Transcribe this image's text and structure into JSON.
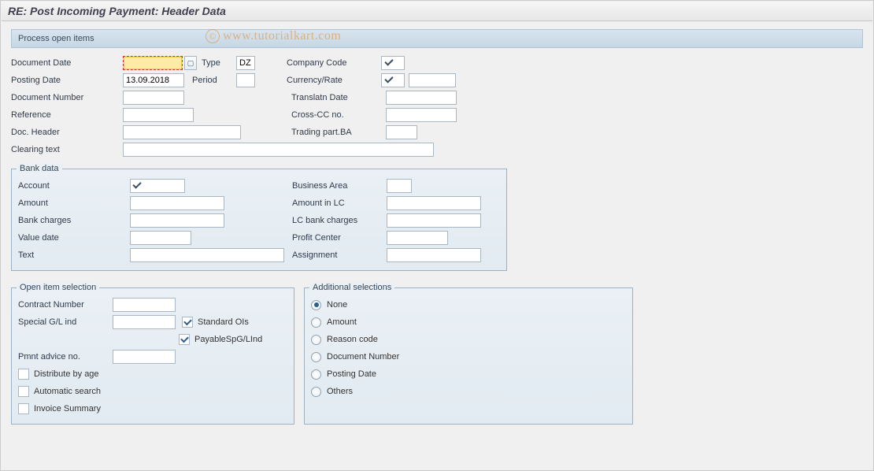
{
  "title": "RE: Post Incoming Payment: Header Data",
  "toolbar": {
    "process_open_items": "Process open items"
  },
  "watermark": "www.tutorialkart.com",
  "header": {
    "document_date_label": "Document Date",
    "document_date": "",
    "type_label": "Type",
    "type": "DZ",
    "posting_date_label": "Posting Date",
    "posting_date": "13.09.2018",
    "period_label": "Period",
    "period": "",
    "document_number_label": "Document Number",
    "document_number": "",
    "reference_label": "Reference",
    "reference": "",
    "doc_header_label": "Doc. Header",
    "doc_header": "",
    "clearing_text_label": "Clearing text",
    "clearing_text": "",
    "company_code_label": "Company Code",
    "company_code": "",
    "currency_rate_label": "Currency/Rate",
    "currency_rate_a": "",
    "currency_rate_b": "",
    "translatn_date_label": "Translatn Date",
    "translatn_date": "",
    "cross_cc_label": "Cross-CC no.",
    "cross_cc": "",
    "trading_part_label": "Trading part.BA",
    "trading_part": ""
  },
  "bank": {
    "legend": "Bank data",
    "account_label": "Account",
    "account": "",
    "amount_label": "Amount",
    "amount": "",
    "bank_charges_label": "Bank charges",
    "bank_charges": "",
    "value_date_label": "Value date",
    "value_date": "",
    "text_label": "Text",
    "text": "",
    "business_area_label": "Business Area",
    "business_area": "",
    "amount_lc_label": "Amount in LC",
    "amount_lc": "",
    "lc_bank_charges_label": "LC bank charges",
    "lc_bank_charges": "",
    "profit_center_label": "Profit Center",
    "profit_center": "",
    "assignment_label": "Assignment",
    "assignment": ""
  },
  "open_item": {
    "legend": "Open item selection",
    "contract_number_label": "Contract Number",
    "contract_number": "",
    "special_gl_label": "Special G/L ind",
    "special_gl": "",
    "standard_ois_label": "Standard OIs",
    "payable_spg_label": "PayableSpG/LInd",
    "pmnt_advice_label": "Pmnt advice no.",
    "pmnt_advice": "",
    "distribute_label": "Distribute by age",
    "automatic_label": "Automatic search",
    "invoice_label": "Invoice Summary"
  },
  "additional": {
    "legend": "Additional selections",
    "none": "None",
    "amount": "Amount",
    "reason_code": "Reason code",
    "document_number": "Document Number",
    "posting_date": "Posting Date",
    "others": "Others"
  }
}
